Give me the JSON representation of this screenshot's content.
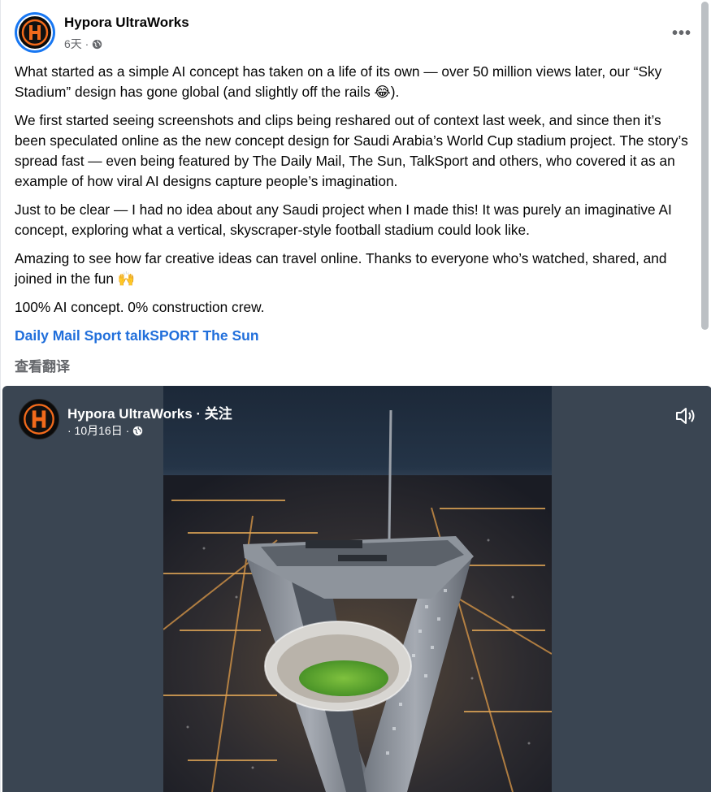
{
  "post": {
    "author": "Hypora UltraWorks",
    "time": "6天 ·",
    "privacy_icon": "globe-icon",
    "more_icon": "more-dots-icon",
    "paragraphs": [
      "What started as a simple AI concept has taken on a life of its own — over 50 million views later, our “Sky Stadium” design has gone global (and slightly off the rails 😂).",
      "We first started seeing screenshots and clips being reshared out of context last week, and since then it’s been speculated online as the new concept design for Saudi Arabia’s World Cup stadium project. The story’s spread fast — even being featured by The Daily Mail, The Sun, TalkSport and others, who covered it as an example of how viral AI designs capture people’s imagination.",
      "Just to be clear — I had no idea about any Saudi project when I made this! It was purely an imaginative AI concept, exploring what a vertical, skyscraper-style football stadium could look like.",
      "Amazing to see how far creative ideas can travel online. Thanks to everyone who’s watched, shared, and joined in the fun 🙌",
      "100% AI concept. 0% construction crew."
    ],
    "tags": [
      "Daily Mail Sport",
      "talkSPORT",
      "The Sun"
    ],
    "translate": "查看翻译"
  },
  "video": {
    "author_line": "Hypora UltraWorks · 关注",
    "date": "· 10月16日 ·",
    "sound_icon": "volume-icon"
  },
  "colors": {
    "link": "#216fdb",
    "meta": "#65676b",
    "avatar_ring": "#1877f2",
    "logo_orange": "#f26a1b"
  }
}
